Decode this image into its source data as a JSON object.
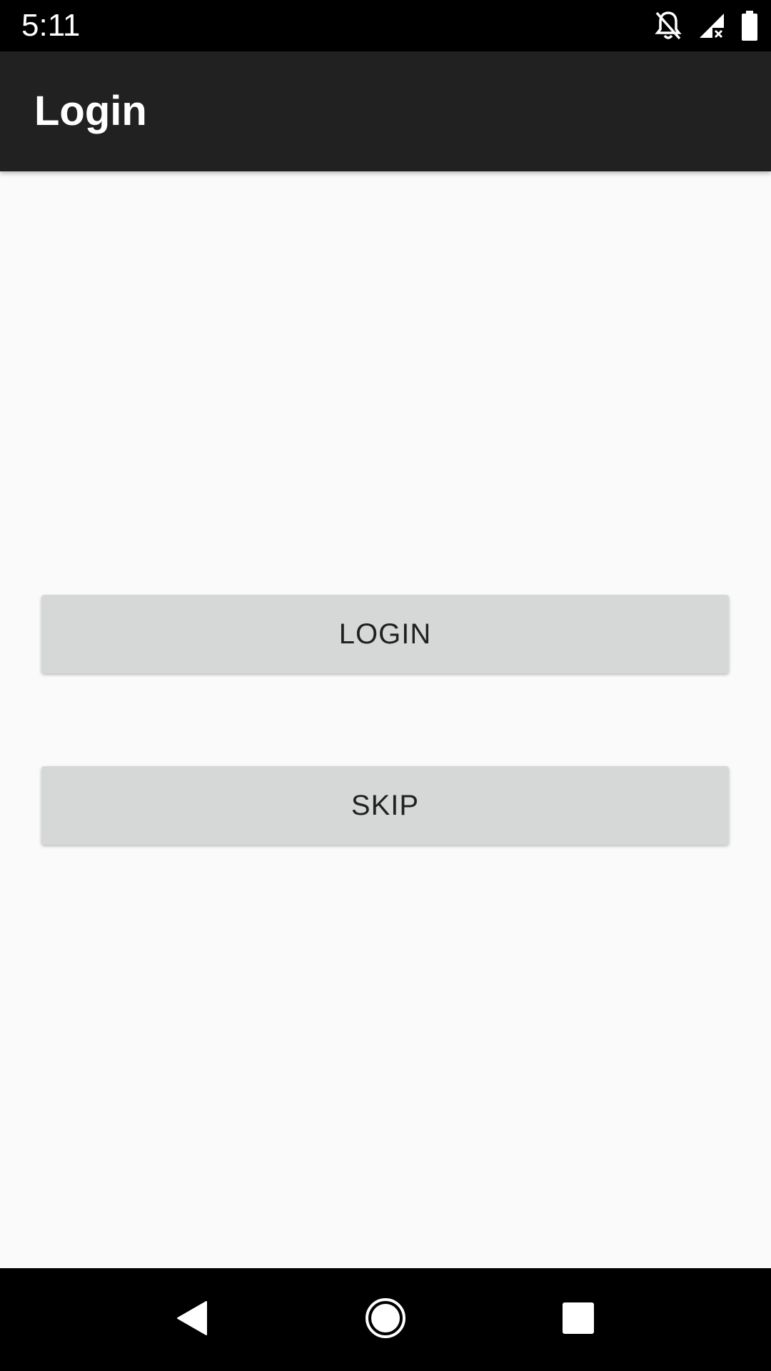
{
  "status_bar": {
    "time": "5:11",
    "icons": [
      "notifications-off-icon",
      "signal-no-data-icon",
      "battery-full-icon"
    ]
  },
  "app_bar": {
    "title": "Login"
  },
  "main": {
    "login_button_label": "LOGIN",
    "skip_button_label": "SKIP"
  },
  "nav_bar": {
    "icons": [
      "back-icon",
      "home-icon",
      "recents-icon"
    ]
  },
  "colors": {
    "status_bar_bg": "#000000",
    "app_bar_bg": "#212121",
    "content_bg": "#fafafa",
    "button_bg": "#d6d7d7",
    "button_text": "#212121",
    "nav_bar_bg": "#000000"
  }
}
